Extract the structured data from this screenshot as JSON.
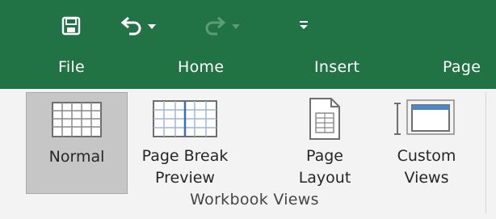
{
  "quick_access": {
    "save_icon": "save-icon",
    "undo_icon": "undo-icon",
    "redo_icon": "redo-icon",
    "customize_icon": "customize-qat-icon"
  },
  "tabs": [
    {
      "label": "File"
    },
    {
      "label": "Home"
    },
    {
      "label": "Insert"
    },
    {
      "label": "Page"
    }
  ],
  "workbook_views": {
    "group_label": "Workbook Views",
    "commands": [
      {
        "label": "Normal",
        "icon": "normal-view-icon",
        "selected": true
      },
      {
        "label": "Page Break\nPreview",
        "icon": "page-break-preview-icon",
        "selected": false
      },
      {
        "label": "Page\nLayout",
        "icon": "page-layout-icon",
        "selected": false
      },
      {
        "label": "Custom\nViews",
        "icon": "custom-views-icon",
        "selected": false
      }
    ]
  },
  "colors": {
    "title_bar": "#217346",
    "ribbon_bg": "#f3f3f3",
    "selected_bg": "#c6c6c6"
  }
}
